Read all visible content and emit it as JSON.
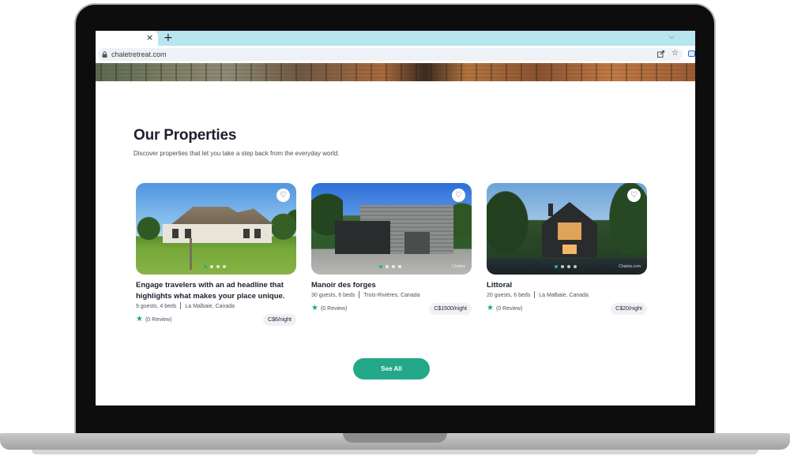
{
  "browser": {
    "tab_close": "×",
    "new_tab": "+",
    "tab_dropdown": "⌵",
    "url": "chaletretreat.com"
  },
  "section": {
    "title": "Our Properties",
    "subtitle": "Discover properties that let you take a step back from the everyday world."
  },
  "properties": [
    {
      "title": "Engage travelers with an ad headline that highlights what makes your place unique.",
      "guests_beds": "9 guests, 4 beds",
      "location": "La Malbaie, Canada",
      "reviews": "(0 Review)",
      "price": "C$6/night",
      "watermark": ""
    },
    {
      "title": "Manoir des forges",
      "guests_beds": "30 guests, 6 beds",
      "location": "Trois-Rivières, Canada",
      "reviews": "(0 Review)",
      "price": "C$1500/night",
      "watermark": "Chalets"
    },
    {
      "title": "Littoral",
      "guests_beds": "20 guests, 6 beds",
      "location": "La Malbaie, Canada",
      "reviews": "(0 Review)",
      "price": "C$20/night",
      "watermark": "Chalets.com"
    }
  ],
  "actions": {
    "see_all": "See All"
  },
  "colors": {
    "accent": "#23a88a",
    "star": "#23a67e",
    "tabbar": "#b7e6f0"
  },
  "icons": {
    "favorite": "heart-icon",
    "rating": "star-icon",
    "lock": "lock-icon",
    "share": "share-icon",
    "bookmark": "bookmark-star-icon"
  }
}
